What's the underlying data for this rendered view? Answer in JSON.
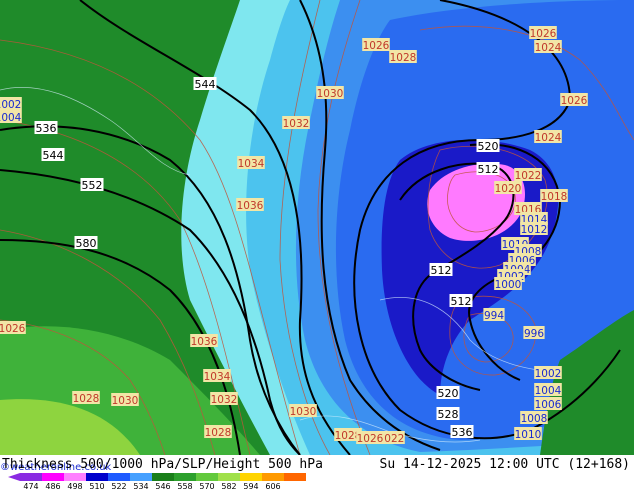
{
  "title": "Thickness 500/1000 hPa/SLP/Height 500 hPa",
  "valid_time": "Su 14-12-2025 12:00 UTC (12+168)",
  "credit": "©weatheronline.co.uk",
  "colorbar": {
    "ticks": [
      "474",
      "486",
      "498",
      "510",
      "522",
      "534",
      "546",
      "558",
      "570",
      "582",
      "594",
      "606"
    ],
    "colors": [
      "#8a2be2",
      "#ff00ff",
      "#ff80ff",
      "#0000cc",
      "#1e5aff",
      "#46a0ff",
      "#1a7f1a",
      "#2ca02c",
      "#62c93c",
      "#a0e04a",
      "#ffd400",
      "#ff9a00",
      "#ff6600"
    ]
  },
  "map": {
    "slp_labels": [
      "1026",
      "1028",
      "1030",
      "1032",
      "1034",
      "1036",
      "1026",
      "1024",
      "1026",
      "1024",
      "1022",
      "1020",
      "1018",
      "1016",
      "1014",
      "1012",
      "1010",
      "1008",
      "1006",
      "1004",
      "1002",
      "1000",
      "994",
      "996",
      "1002",
      "1004",
      "1006",
      "1008",
      "1010",
      "1036",
      "1034",
      "1032",
      "1030",
      "1028",
      "1030",
      "1028",
      "1026",
      "1022",
      "1028",
      "1026",
      "1002",
      "1004"
    ],
    "height_labels": [
      "544",
      "536",
      "544",
      "552",
      "580",
      "520",
      "512",
      "512",
      "512",
      "520",
      "528",
      "536"
    ]
  }
}
